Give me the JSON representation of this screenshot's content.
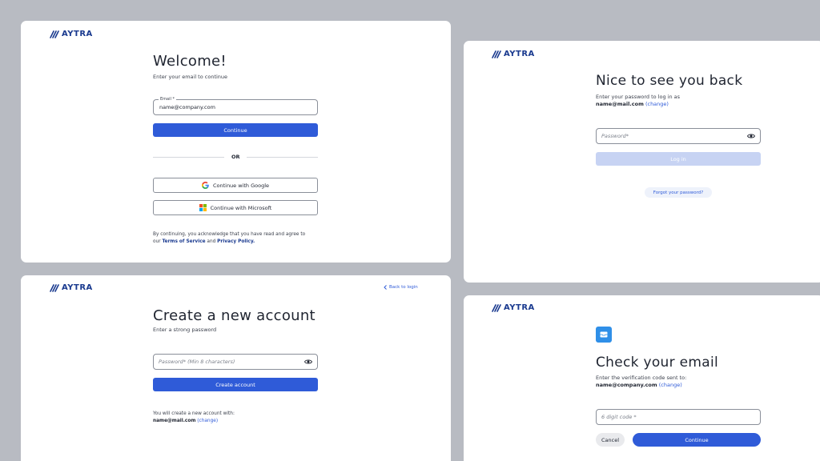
{
  "brand": {
    "name": "AYTRA"
  },
  "welcome": {
    "title": "Welcome!",
    "subtitle": "Enter your email to continue",
    "email_label": "Email *",
    "email_value": "name@company.com",
    "continue_label": "Continue",
    "or_label": "OR",
    "google_label": "Continue with Google",
    "microsoft_label": "Continue with Microsoft",
    "legal_prefix": "By continuing, you acknowledge that you have read and agree to",
    "legal_our": "our",
    "terms_label": "Terms of Service",
    "and_label": "and",
    "privacy_label": "Privacy Policy."
  },
  "login": {
    "title": "Nice to see you back",
    "subtitle": "Enter your password to log in as",
    "email": "name@mail.com",
    "change_label": "(change)",
    "password_placeholder": "Password*",
    "login_label": "Log in",
    "forgot_label": "Forgot your password?"
  },
  "create": {
    "back_label": "Back to login",
    "title": "Create a new account",
    "subtitle": "Enter a strong password",
    "password_placeholder": "Password* (Min 8 characters)",
    "create_label": "Create account",
    "info_text": "You will create a new account with:",
    "email": "name@mail.com",
    "change_label": "(change)"
  },
  "verify": {
    "title": "Check your email",
    "subtitle": "Enter the verification code sent to:",
    "email": "name@company.com",
    "change_label": "(change)",
    "code_placeholder": "6 digit code *",
    "cancel_label": "Cancel",
    "continue_label": "Continue"
  },
  "colors": {
    "background": "#b8bbc2",
    "primary": "#2f5bd8",
    "primary_disabled": "#c7d3f3",
    "brand": "#1a3a8f",
    "mail_icon": "#2f8fe8"
  }
}
